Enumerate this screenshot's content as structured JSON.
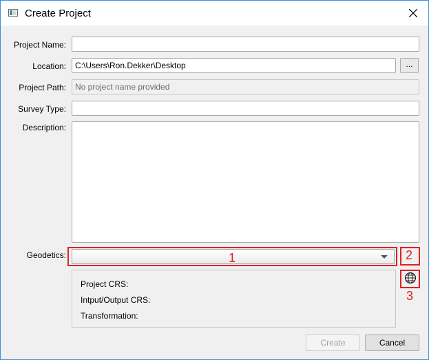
{
  "window": {
    "title": "Create Project"
  },
  "form": {
    "project_name": {
      "label": "Project Name:",
      "value": ""
    },
    "location": {
      "label": "Location:",
      "value": "C:\\Users\\Ron.Dekker\\Desktop",
      "browse_label": "..."
    },
    "project_path": {
      "label": "Project Path:",
      "placeholder": "No project name provided"
    },
    "survey_type": {
      "label": "Survey Type:",
      "value": ""
    },
    "description": {
      "label": "Description:",
      "value": ""
    },
    "geodetics": {
      "label": "Geodetics:",
      "selected": ""
    }
  },
  "crs_info": {
    "project_crs": "Project CRS:",
    "io_crs": "Intput/Output CRS:",
    "transformation": "Transformation:"
  },
  "annotations": {
    "box1": "1",
    "box2": "2",
    "box3": "3"
  },
  "buttons": {
    "create": "Create",
    "cancel": "Cancel"
  },
  "icons": {
    "app": "app-window-icon",
    "close": "close-icon",
    "globe": "globe-icon",
    "dropdown": "chevron-down-icon"
  },
  "colors": {
    "annotation": "#e02020",
    "window_border": "#3b8fd8"
  }
}
